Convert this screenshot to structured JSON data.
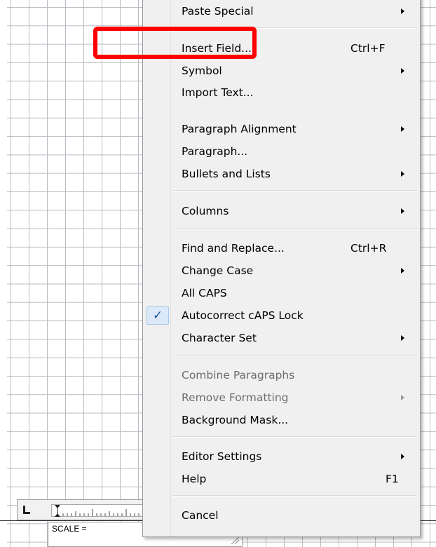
{
  "menu": {
    "items": [
      {
        "id": "paste-special",
        "label": "Paste Special",
        "submenu": true
      },
      {
        "id": "insert-field",
        "label": "Insert Field...",
        "shortcut": "Ctrl+F"
      },
      {
        "id": "symbol",
        "label": "Symbol",
        "submenu": true
      },
      {
        "id": "import-text",
        "label": "Import Text..."
      },
      {
        "id": "paragraph-alignment",
        "label": "Paragraph Alignment",
        "submenu": true
      },
      {
        "id": "paragraph",
        "label": "Paragraph..."
      },
      {
        "id": "bullets-and-lists",
        "label": "Bullets and Lists",
        "submenu": true
      },
      {
        "id": "columns",
        "label": "Columns",
        "submenu": true
      },
      {
        "id": "find-and-replace",
        "label": "Find and Replace...",
        "shortcut": "Ctrl+R"
      },
      {
        "id": "change-case",
        "label": "Change Case",
        "submenu": true
      },
      {
        "id": "all-caps",
        "label": "All CAPS"
      },
      {
        "id": "autocorrect-caps-lock",
        "label": "Autocorrect cAPS Lock",
        "checked": true
      },
      {
        "id": "character-set",
        "label": "Character Set",
        "submenu": true
      },
      {
        "id": "combine-paragraphs",
        "label": "Combine Paragraphs",
        "disabled": true
      },
      {
        "id": "remove-formatting",
        "label": "Remove Formatting",
        "disabled": true,
        "submenu": true
      },
      {
        "id": "background-mask",
        "label": "Background Mask..."
      },
      {
        "id": "editor-settings",
        "label": "Editor Settings",
        "submenu": true
      },
      {
        "id": "help",
        "label": "Help",
        "shortcut": "F1"
      },
      {
        "id": "cancel",
        "label": "Cancel"
      }
    ],
    "check_mark": "✓"
  },
  "highlighted_item": "insert-field",
  "highlight_color": "#ff0000",
  "scale": {
    "label": "SCALE ="
  },
  "icons": {
    "submenu": "submenu-arrow-icon",
    "check": "check-icon",
    "ruler_corner": "tab-stop-icon",
    "grip": "resize-grip-icon"
  }
}
